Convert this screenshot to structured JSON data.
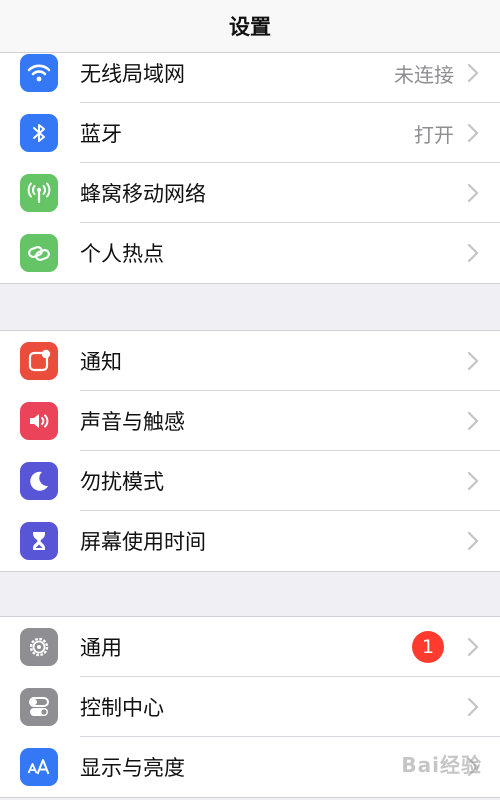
{
  "navbar": {
    "title": "设置"
  },
  "groups": [
    {
      "items": [
        {
          "label": "无线局域网",
          "value": "未连接",
          "icon": "wifi-icon",
          "color": "#3478f6"
        },
        {
          "label": "蓝牙",
          "value": "打开",
          "icon": "bluetooth-icon",
          "color": "#3478f6"
        },
        {
          "label": "蜂窝移动网络",
          "icon": "cellular-antenna-icon",
          "color": "#65c466"
        },
        {
          "label": "个人热点",
          "icon": "hotspot-chain-icon",
          "color": "#65c466"
        }
      ]
    },
    {
      "items": [
        {
          "label": "通知",
          "icon": "notification-icon",
          "color": "#eb4d3d"
        },
        {
          "label": "声音与触感",
          "icon": "speaker-icon",
          "color": "#eb445a"
        },
        {
          "label": "勿扰模式",
          "icon": "moon-icon",
          "color": "#5856d6"
        },
        {
          "label": "屏幕使用时间",
          "icon": "hourglass-icon",
          "color": "#5856d6"
        }
      ]
    },
    {
      "items": [
        {
          "label": "通用",
          "badge": "1",
          "icon": "gear-icon",
          "color": "#8e8e93"
        },
        {
          "label": "控制中心",
          "icon": "toggle-switches-icon",
          "color": "#8e8e93"
        },
        {
          "label": "显示与亮度",
          "icon": "text-size-icon",
          "color": "#3478f6"
        }
      ]
    }
  ],
  "watermark": "Bai经验"
}
